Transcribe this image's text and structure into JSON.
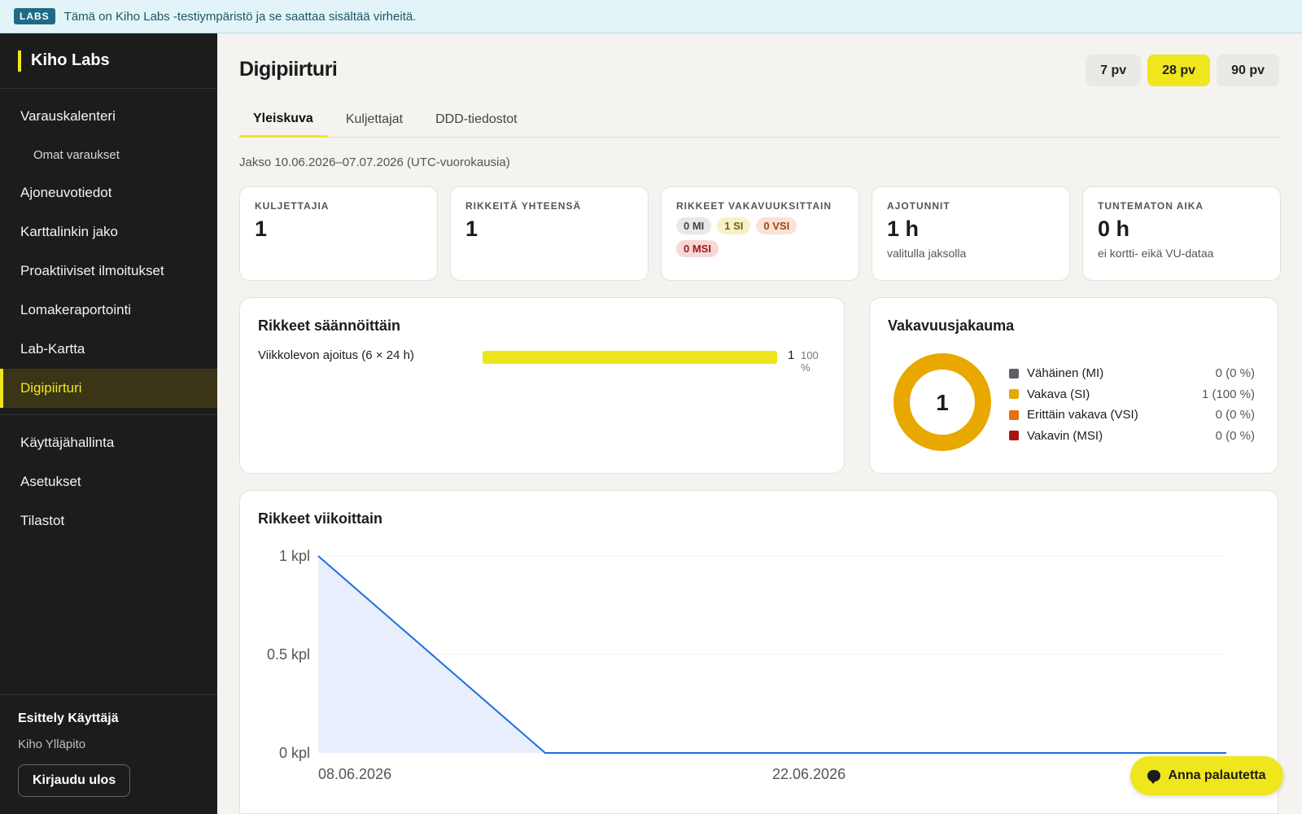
{
  "banner": {
    "badge": "LABS",
    "text": "Tämä on Kiho Labs -testiympäristö ja se saattaa sisältää virheitä."
  },
  "sidebar": {
    "brand": "Kiho Labs",
    "items": [
      {
        "label": "Varauskalenteri"
      },
      {
        "label": "Omat varaukset"
      },
      {
        "label": "Ajoneuvotiedot"
      },
      {
        "label": "Karttalinkin jako"
      },
      {
        "label": "Proaktiiviset ilmoitukset"
      },
      {
        "label": "Lomakeraportointi"
      },
      {
        "label": "Lab-Kartta"
      },
      {
        "label": "Digipiirturi"
      },
      {
        "label": "Käyttäjähallinta"
      },
      {
        "label": "Asetukset"
      },
      {
        "label": "Tilastot"
      }
    ],
    "active_item": "Digipiirturi",
    "user_name": "Esittely Käyttäjä",
    "user_org": "Kiho Ylläpito",
    "logout_label": "Kirjaudu ulos"
  },
  "header": {
    "title": "Digipiirturi",
    "ranges": [
      "7 pv",
      "28 pv",
      "90 pv"
    ],
    "active_range": "28 pv"
  },
  "tabs": {
    "items": [
      "Yleiskuva",
      "Kuljettajat",
      "DDD-tiedostot"
    ],
    "active": "Yleiskuva"
  },
  "period_text": "Jakso 10.06.2026–07.07.2026 (UTC-vuorokausia)",
  "kpis": {
    "drivers": {
      "label": "KULJETTAJIA",
      "value": "1"
    },
    "violations_total": {
      "label": "RIKKEITÄ YHTEENSÄ",
      "value": "1"
    },
    "by_severity": {
      "label": "RIKKEET VAKAVUUKSITTAIN",
      "mi": "0 MI",
      "si": "1 SI",
      "vsi": "0 VSI",
      "msi": "0 MSI"
    },
    "driving_hours": {
      "label": "AJOTUNNIT",
      "value": "1 h",
      "sub": "valitulla jaksolla"
    },
    "unknown_time": {
      "label": "TUNTEMATON AIKA",
      "value": "0 h",
      "sub": "ei kortti- eikä VU-dataa"
    }
  },
  "rules_card": {
    "title": "Rikkeet säännöittäin",
    "rows": [
      {
        "label": "Viikkolevon ajoitus (6 × 24 h)",
        "count": "1",
        "percent": "100 %",
        "fraction": 1.0
      }
    ]
  },
  "severity_card": {
    "title": "Vakavuusjakauma",
    "total": "1",
    "legend": [
      {
        "label": "Vähäinen (MI)",
        "value": "0 (0 %)",
        "count": 0,
        "color": "#5c5f66"
      },
      {
        "label": "Vakava (SI)",
        "value": "1 (100 %)",
        "count": 1,
        "color": "#e8a800"
      },
      {
        "label": "Erittäin vakava (VSI)",
        "value": "0 (0 %)",
        "count": 0,
        "color": "#e5700f"
      },
      {
        "label": "Vakavin (MSI)",
        "value": "0 (0 %)",
        "count": 0,
        "color": "#a81414"
      }
    ]
  },
  "weekly_card": {
    "title": "Rikkeet viikoittain"
  },
  "chart_data": {
    "type": "area",
    "title": "Rikkeet viikoittain",
    "x": [
      "08.06.2026",
      "15.06.2026",
      "22.06.2026",
      "29.06.2026",
      "06.07.2026"
    ],
    "x_tick_labels": [
      "08.06.2026",
      "22.06.2026"
    ],
    "y_tick_labels": [
      "1 kpl",
      "0.5 kpl",
      "0 kpl"
    ],
    "ylim": [
      0,
      1
    ],
    "series": [
      {
        "values": [
          1,
          0,
          0,
          0,
          0
        ],
        "color": "#1a6fe0"
      }
    ],
    "grid": true
  },
  "feedback": {
    "label": "Anna palautetta"
  }
}
